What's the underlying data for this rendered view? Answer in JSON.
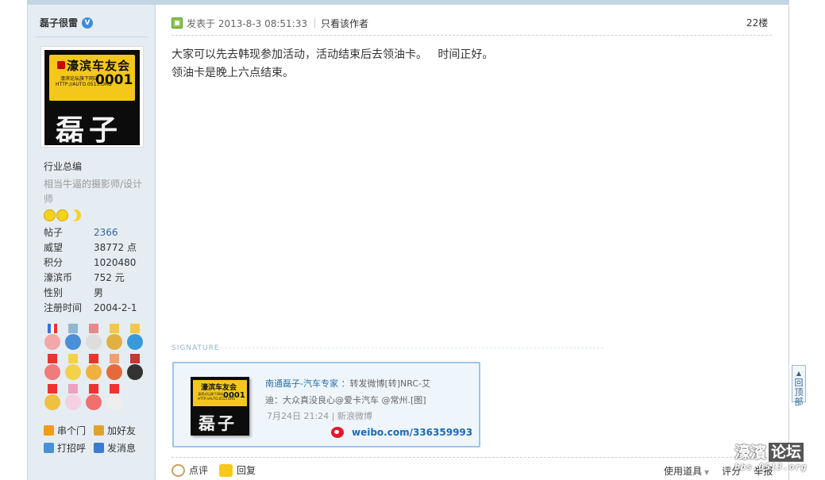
{
  "author": {
    "name": "磊子很雷",
    "verify_icon": "V",
    "avatar": {
      "logo_title": "濠滨车友会",
      "logo_sub1": "濠滨论坛旗下网站",
      "logo_sub2": "HTTP://AUTO.0513.ORG",
      "logo_number": "0001",
      "logo_name": "磊子"
    },
    "user_title": "行业总编",
    "description": "相当牛逼的摄影师/设计师",
    "stats": [
      {
        "label": "帖子",
        "value": "2366"
      },
      {
        "label": "威望",
        "value": "38772 点"
      },
      {
        "label": "积分",
        "value": "1020480"
      },
      {
        "label": "濠滨币",
        "value": "752 元"
      },
      {
        "label": "性别",
        "value": "男"
      },
      {
        "label": "注册时间",
        "value": "2004-2-1"
      }
    ],
    "actions": [
      {
        "label": "串个门",
        "icon": "home-icon",
        "color": "#f39c12"
      },
      {
        "label": "加好友",
        "icon": "handshake-icon",
        "color": "#e0a32a"
      },
      {
        "label": "打招呼",
        "icon": "chat-icon",
        "color": "#4a90d9"
      },
      {
        "label": "发消息",
        "icon": "mail-icon",
        "color": "#3a7bd5"
      }
    ]
  },
  "post": {
    "meta_posted": "发表于 2013-8-3 08:51:33",
    "only_author": "只看该作者",
    "floor": "22楼",
    "body_line1": "大家可以先去韩现参加活动，活动结束后去领油卡。   时间正好。",
    "body_line2": "领油卡是晚上六点结束。"
  },
  "signature": {
    "label": "SIGNATURE",
    "card": {
      "avatar_title": "濠滨车友会",
      "avatar_sub": "濠滨论坛旗下网站 HTTP://AUTO.0513.ORG",
      "avatar_number": "0001",
      "avatar_name": "磊子",
      "author_link": "南通磊子-汽车专家",
      "text_after_link": " ：转发微博[转]NRC-艾",
      "text_line2": "迪：大众真没良心@爱卡汽车 @常州.[图]",
      "time": "7月24日 21:24 | 新浪微博",
      "weibo_url": "weibo.com/336359993"
    }
  },
  "bottom_actions": {
    "comment": "点评",
    "reply": "回复",
    "tools": "使用道具",
    "rate": "评分",
    "report": "举报"
  },
  "back_to_top": {
    "line1": "回",
    "line2": "顶",
    "line3": "部"
  },
  "watermark": {
    "part1": "濠濱",
    "part2": "论坛",
    "url": "bbs.0513.org"
  }
}
